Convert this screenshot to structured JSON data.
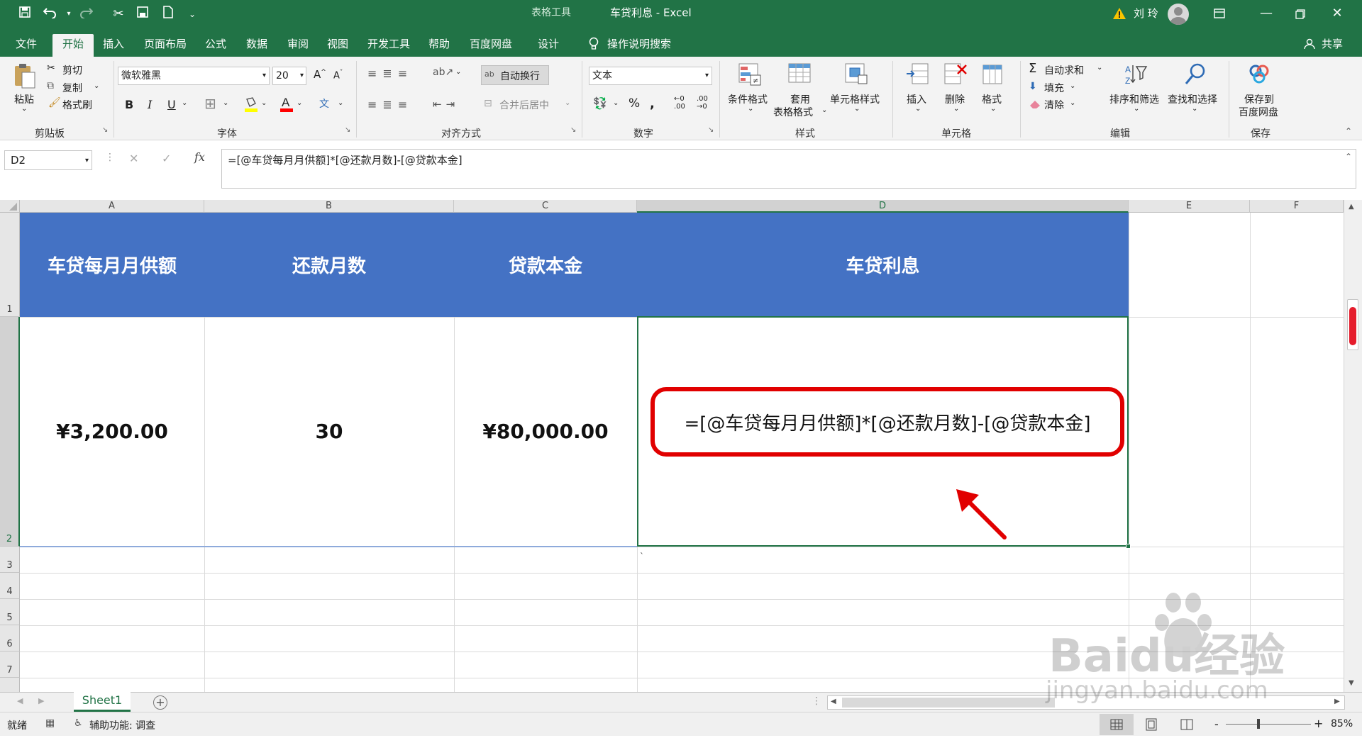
{
  "app": {
    "ctx_tools": "表格工具",
    "title": "车贷利息  -  Excel",
    "user": "刘 玲"
  },
  "tabs": [
    "文件",
    "开始",
    "插入",
    "页面布局",
    "公式",
    "数据",
    "审阅",
    "视图",
    "开发工具",
    "帮助",
    "百度网盘",
    "设计"
  ],
  "tell_me": "操作说明搜索",
  "share": "共享",
  "ribbon": {
    "clipboard": {
      "paste": "粘贴",
      "cut": "剪切",
      "copy": "复制",
      "painter": "格式刷",
      "label": "剪贴板"
    },
    "font": {
      "name": "微软雅黑",
      "size": "20",
      "label": "字体",
      "bold": "B",
      "italic": "I",
      "underline": "U"
    },
    "align": {
      "wrap": "自动换行",
      "merge": "合并后居中",
      "label": "对齐方式"
    },
    "number": {
      "format": "文本",
      "label": "数字",
      "percent": "%"
    },
    "styles": {
      "cond": "条件格式",
      "table1": "套用",
      "table2": "表格格式",
      "cell": "单元格样式",
      "label": "样式"
    },
    "cells": {
      "insert": "插入",
      "delete": "删除",
      "format": "格式",
      "label": "单元格"
    },
    "edit": {
      "autosum": "自动求和",
      "fill": "填充",
      "clear": "清除",
      "sort": "排序和筛选",
      "find": "查找和选择",
      "label": "编辑"
    },
    "save": {
      "l1": "保存到",
      "l2": "百度网盘",
      "label": "保存"
    }
  },
  "formula_bar": {
    "name_box": "D2",
    "formula": "=[@车贷每月月供额]*[@还款月数]-[@贷款本金]"
  },
  "columns": [
    "A",
    "B",
    "C",
    "D",
    "E",
    "F"
  ],
  "rows": [
    "1",
    "2",
    "3",
    "4",
    "5",
    "6",
    "7"
  ],
  "table": {
    "headers": [
      "车贷每月月供额",
      "还款月数",
      "贷款本金",
      "车贷利息"
    ],
    "row2": [
      "¥3,200.00",
      "30",
      "¥80,000.00"
    ],
    "d2_formula": "=[@车贷每月月供额]*[@还款月数]-[@贷款本金]"
  },
  "stray_mark": "`",
  "sheet_tab": "Sheet1",
  "status": {
    "ready": "就绪",
    "accessibility": "辅助功能: 调查",
    "zoom": "85%",
    "minus": "-",
    "plus": "+"
  },
  "watermark": {
    "line1": "Baidu经验",
    "line2": "jingyan.baidu.com"
  },
  "colors": {
    "excel_green": "#217346",
    "header_blue": "#4472c4",
    "annotation_red": "#e10000"
  }
}
